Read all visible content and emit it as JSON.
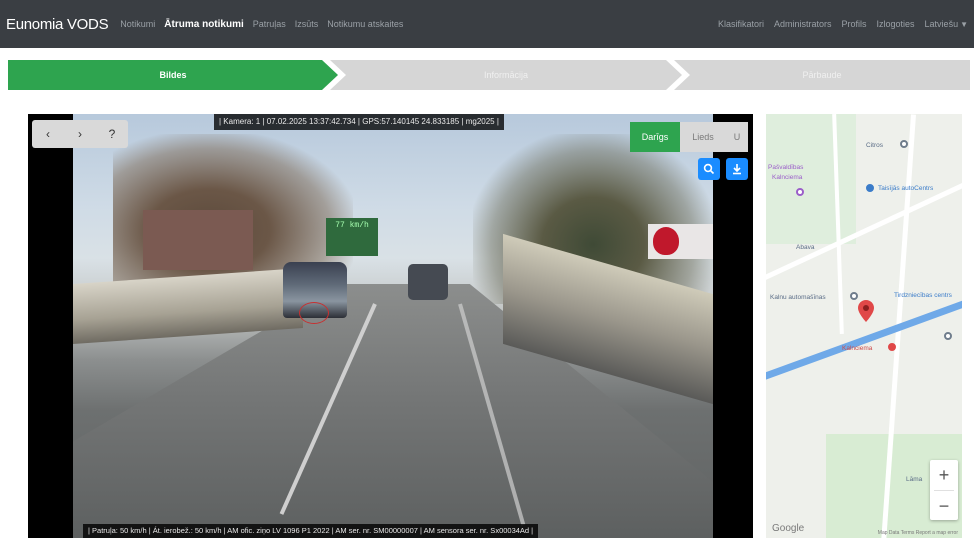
{
  "navbar": {
    "brand": "Eunomia VODS",
    "left_items": [
      "Notikumi",
      "Ātruma notikumi",
      "Patruļas",
      "Izsūts",
      "Notikumu atskaites"
    ],
    "active_item": "Ātruma notikumi",
    "right_items": [
      "Klasifikatori",
      "Administrators",
      "Profils",
      "Izlogoties"
    ],
    "language": "Latviešu"
  },
  "steps": [
    "Bildes",
    "Informācija",
    "Pārbaude"
  ],
  "video": {
    "info_bar": "| Kamera: 1 | 07.02.2025 13:37:42.734 | GPS:57.140145 24.833185 | mg2025 |",
    "bottom_bar": "| Patruļa: 50 km/h | Át. ierobež.: 50 km/h | AM ofic. ziņo LV 1096 P1 2022 | AM ser. nr. SM00000007 | AM sensora ser. nr. Sx00034Ad |",
    "nav_prev": "‹",
    "nav_next": "›",
    "nav_help": "?",
    "toggle_active": "Darīgs",
    "toggle_inactive": "Lieds",
    "toggle_aux": "U",
    "sign_text": "77 km/h"
  },
  "map": {
    "labels": [
      {
        "text": "Citros",
        "kind": "default"
      },
      {
        "text": "Pašvaldības",
        "kind": "purple"
      },
      {
        "text": "Kalnciema",
        "kind": "purple"
      },
      {
        "text": "Taisījās autoCentrs",
        "kind": "blue"
      },
      {
        "text": "Abava",
        "kind": "default"
      },
      {
        "text": "Kalnu automašīnas",
        "kind": "default"
      },
      {
        "text": "Tirdzniecības centrs",
        "kind": "blue"
      },
      {
        "text": "Kalnciema",
        "kind": "red"
      },
      {
        "text": "Lāma",
        "kind": "default"
      }
    ],
    "google": "Google",
    "footer": "Map Data   Terms   Report a map error",
    "zoom_in": "+",
    "zoom_out": "−"
  },
  "colors": {
    "navbar_bg": "#3a3e43",
    "step_active": "#2ea44f",
    "step_inactive": "#d6d6d6",
    "icon_button": "#1a8cff",
    "marker": "#e04848"
  }
}
